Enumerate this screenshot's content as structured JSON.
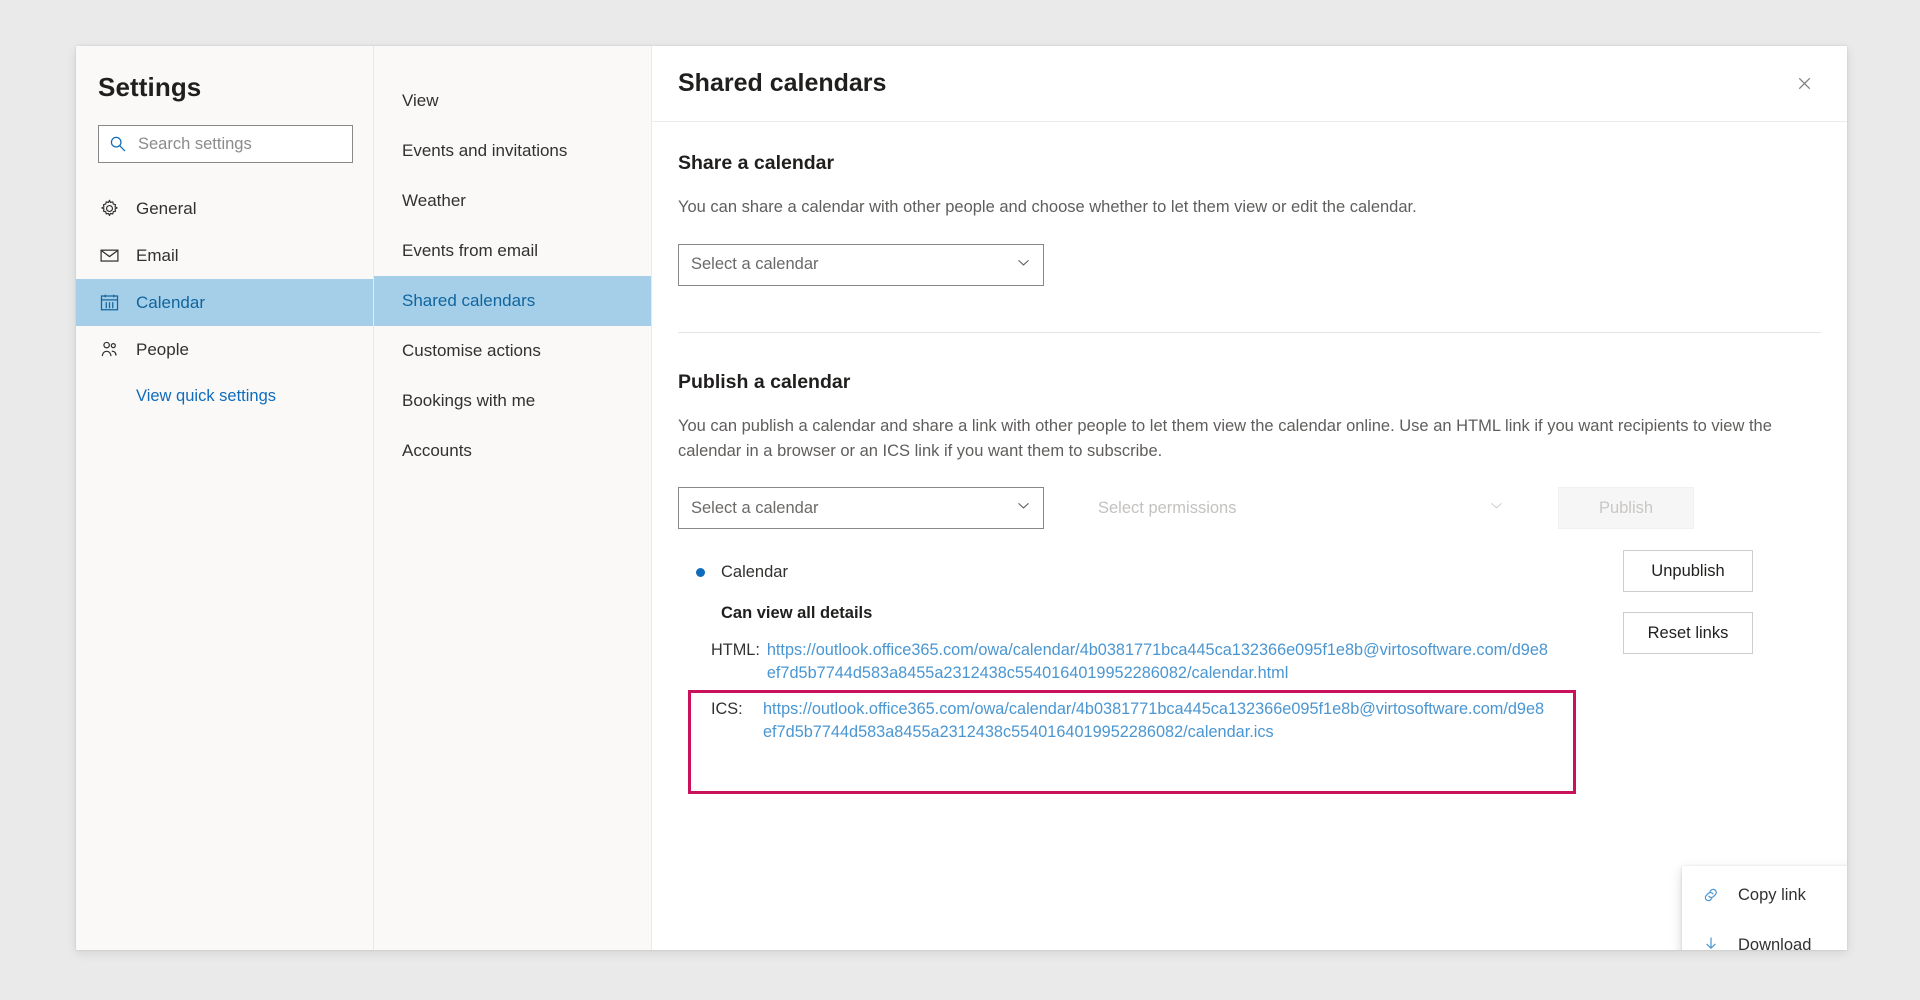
{
  "settings_panel": {
    "title": "Settings",
    "search": {
      "placeholder": "Search settings",
      "value": "",
      "icon": "search-icon"
    },
    "items": [
      {
        "label": "General",
        "icon": "gear-icon",
        "selected": false
      },
      {
        "label": "Email",
        "icon": "envelope-icon",
        "selected": false
      },
      {
        "label": "Calendar",
        "icon": "calendar-icon",
        "selected": true
      },
      {
        "label": "People",
        "icon": "people-icon",
        "selected": false
      }
    ],
    "quick_settings_link": "View quick settings"
  },
  "category_panel": {
    "items": [
      {
        "label": "View",
        "selected": false
      },
      {
        "label": "Events and invitations",
        "selected": false
      },
      {
        "label": "Weather",
        "selected": false
      },
      {
        "label": "Events from email",
        "selected": false
      },
      {
        "label": "Shared calendars",
        "selected": true
      },
      {
        "label": "Customise actions",
        "selected": false
      },
      {
        "label": "Bookings with me",
        "selected": false
      },
      {
        "label": "Accounts",
        "selected": false
      }
    ]
  },
  "detail": {
    "title": "Shared calendars",
    "close_icon": "close-icon",
    "share_section": {
      "heading": "Share a calendar",
      "description": "You can share a calendar with other people and choose whether to let them view or edit the calendar.",
      "calendar_select": {
        "value": "Select a calendar",
        "chevron": "chevron-down-icon"
      }
    },
    "publish_section": {
      "heading": "Publish a calendar",
      "description": "You can publish a calendar and share a link with other people to let them view the calendar online. Use an HTML link if you want recipients to view the calendar in a browser or an ICS link if you want them to subscribe.",
      "calendar_select": {
        "value": "Select a calendar",
        "chevron": "chevron-down-icon"
      },
      "permissions_select": {
        "value": "Select permissions",
        "chevron": "chevron-down-icon"
      },
      "publish_button": "Publish",
      "published_calendar": {
        "name": "Calendar",
        "bullet_color": "#0f6cbd",
        "permission": "Can view all details",
        "html_label": "HTML:",
        "html_url": "https://outlook.office365.com/owa/calendar/4b0381771bca445ca132366e095f1e8b@virtosoftware.com/d9e8ef7d5b7744d583a8455a2312438c5540164019952286082/calendar.html",
        "ics_label": "ICS:",
        "ics_url": "https://outlook.office365.com/owa/calendar/4b0381771bca445ca132366e095f1e8b@virtosoftware.com/d9e8ef7d5b7744d583a8455a2312438c5540164019952286082/calendar.ics",
        "unpublish_button": "Unpublish",
        "reset_links_button": "Reset links",
        "highlight_color": "#c9115c"
      }
    }
  },
  "context_menu": {
    "items": [
      {
        "label": "Copy link",
        "icon": "copy-link-icon"
      },
      {
        "label": "Download",
        "icon": "download-icon"
      }
    ]
  },
  "colors": {
    "accent": "#0f6cbd",
    "selection": "#a5cfe8",
    "link": "#4a96d2",
    "highlight": "#c9115c",
    "page_background": "#eaeaea"
  }
}
